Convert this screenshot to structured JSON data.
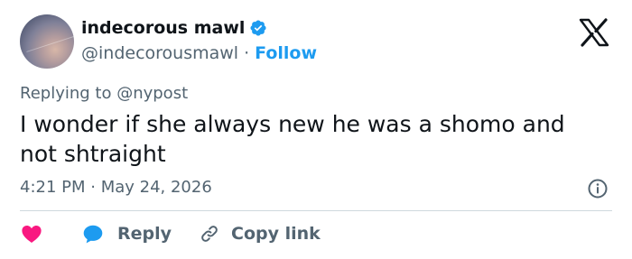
{
  "author": {
    "display_name": "indecorous mawl",
    "handle": "@indecorousmawl",
    "separator": "·",
    "follow_label": "Follow"
  },
  "tweet": {
    "replying_to": "Replying to @nypost",
    "text": "I wonder if she always new he was a shomo and not shtraight",
    "timestamp": "4:21 PM · May 24, 2026"
  },
  "actions": {
    "reply_label": "Reply",
    "copy_link_label": "Copy link"
  },
  "colors": {
    "accent": "#1d9bf0",
    "like": "#f91880",
    "secondary_text": "#536471"
  },
  "icons": [
    "verified-badge-icon",
    "x-logo-icon",
    "info-icon",
    "heart-icon",
    "reply-bubble-icon",
    "link-icon"
  ]
}
